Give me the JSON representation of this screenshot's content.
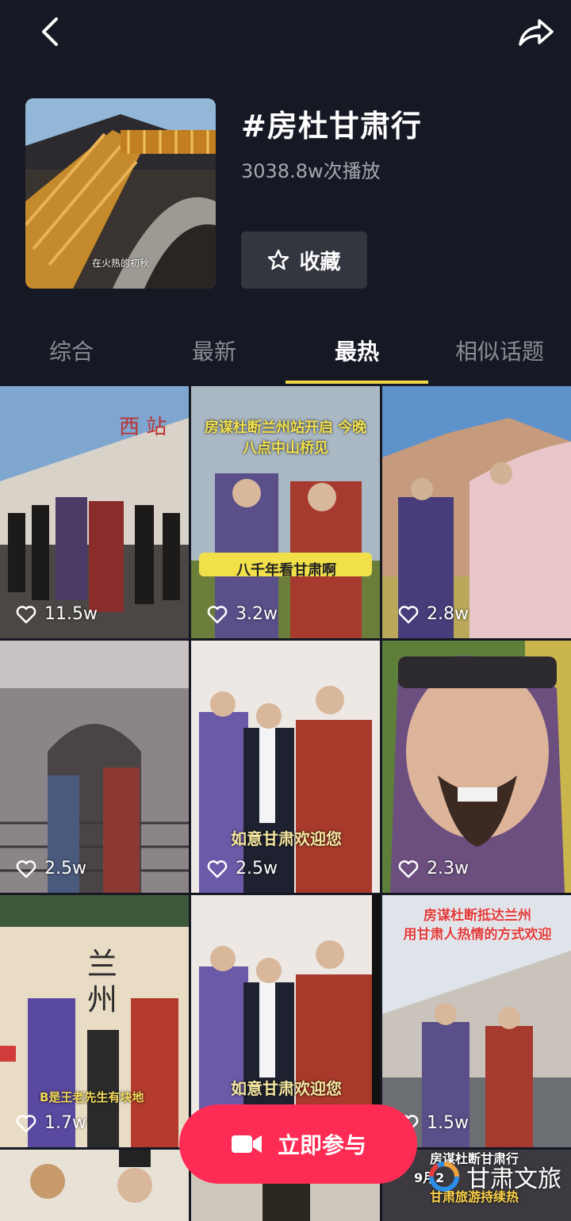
{
  "topbar": {
    "back_icon": "chevron-left-icon",
    "share_icon": "share-arrow-icon"
  },
  "header": {
    "title": "#房杜甘肃行",
    "play_count": "3038.8w次播放",
    "favorite_label": "收藏",
    "cover_caption": "在火热的初秋"
  },
  "tabs": [
    {
      "label": "综合",
      "active": false
    },
    {
      "label": "最新",
      "active": false
    },
    {
      "label": "最热",
      "active": true
    },
    {
      "label": "相似话题",
      "active": false
    }
  ],
  "accent_color": "#f0d94a",
  "cta_color": "#fe2c55",
  "videos": [
    {
      "likes": "11.5w",
      "overlay": ""
    },
    {
      "likes": "3.2w",
      "overlay": "房谋杜断兰州站开启 今晚八点中山桥见",
      "overlay2": "八千年看甘肃啊"
    },
    {
      "likes": "2.8w",
      "overlay": ""
    },
    {
      "likes": "2.5w",
      "overlay": ""
    },
    {
      "likes": "2.5w",
      "overlay": "如意甘肃欢迎您"
    },
    {
      "likes": "2.3w",
      "overlay": ""
    },
    {
      "likes": "1.7w",
      "overlay": "B是王老先生有块地"
    },
    {
      "likes": "",
      "overlay": "如意甘肃欢迎您"
    },
    {
      "likes": "1.5w",
      "overlay": "房谋杜断抵达兰州",
      "overlay2": "用甘肃人热情的方式欢迎"
    }
  ],
  "bottom_row": {
    "caption": "房谋杜断甘肃行",
    "subcaption": "9月2",
    "tag": "甘肃旅游持续热"
  },
  "join_button": {
    "label": "立即参与",
    "icon": "video-camera-icon"
  },
  "watermark": {
    "text": "甘肃文旅"
  }
}
